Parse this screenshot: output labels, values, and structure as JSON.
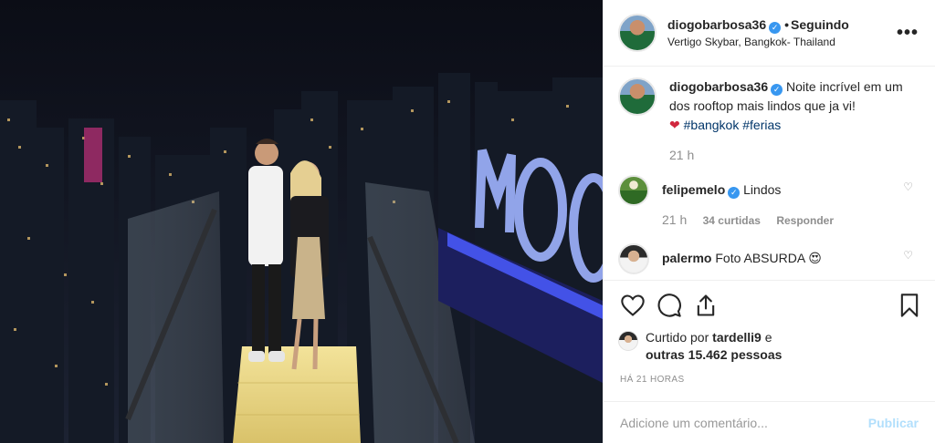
{
  "post": {
    "author": {
      "username": "diogobarbosa36",
      "verified_glyph": "✓",
      "dot": "•",
      "follow_status": "Seguindo",
      "location": "Vertigo Skybar, Bangkok- Thailand",
      "more_label": "•••"
    },
    "photo": {
      "sign_text": "MOO"
    },
    "caption": {
      "username": "diogobarbosa36",
      "text": "Noite incrível em um dos rooftop mais lindos que ja vi!",
      "emoji": "❤",
      "hashtags": [
        "#bangkok",
        "#ferias"
      ],
      "time": "21 h"
    },
    "comments": [
      {
        "username": "felipemelo",
        "verified": true,
        "text": "Lindos",
        "time": "21 h",
        "likes": "34 curtidas",
        "reply": "Responder"
      },
      {
        "username": "palermo",
        "verified": false,
        "text": "Foto ABSURDA",
        "emoji": "😍"
      }
    ],
    "likes": {
      "prefix": "Curtido por",
      "user": "tardelli9",
      "suffix": "e",
      "others": "outras 15.462 pessoas"
    },
    "timestamp": "HÁ 21 HORAS",
    "add_comment": {
      "placeholder": "Adicione um comentário...",
      "publish_label": "Publicar"
    },
    "icons": {
      "like": "heart-icon",
      "comment": "comment-icon",
      "share": "share-icon",
      "save": "bookmark-icon"
    },
    "colors": {
      "link": "#003569",
      "verified": "#3897f0",
      "publish_disabled": "#b2dffc",
      "muted": "#8e8e8e"
    }
  }
}
